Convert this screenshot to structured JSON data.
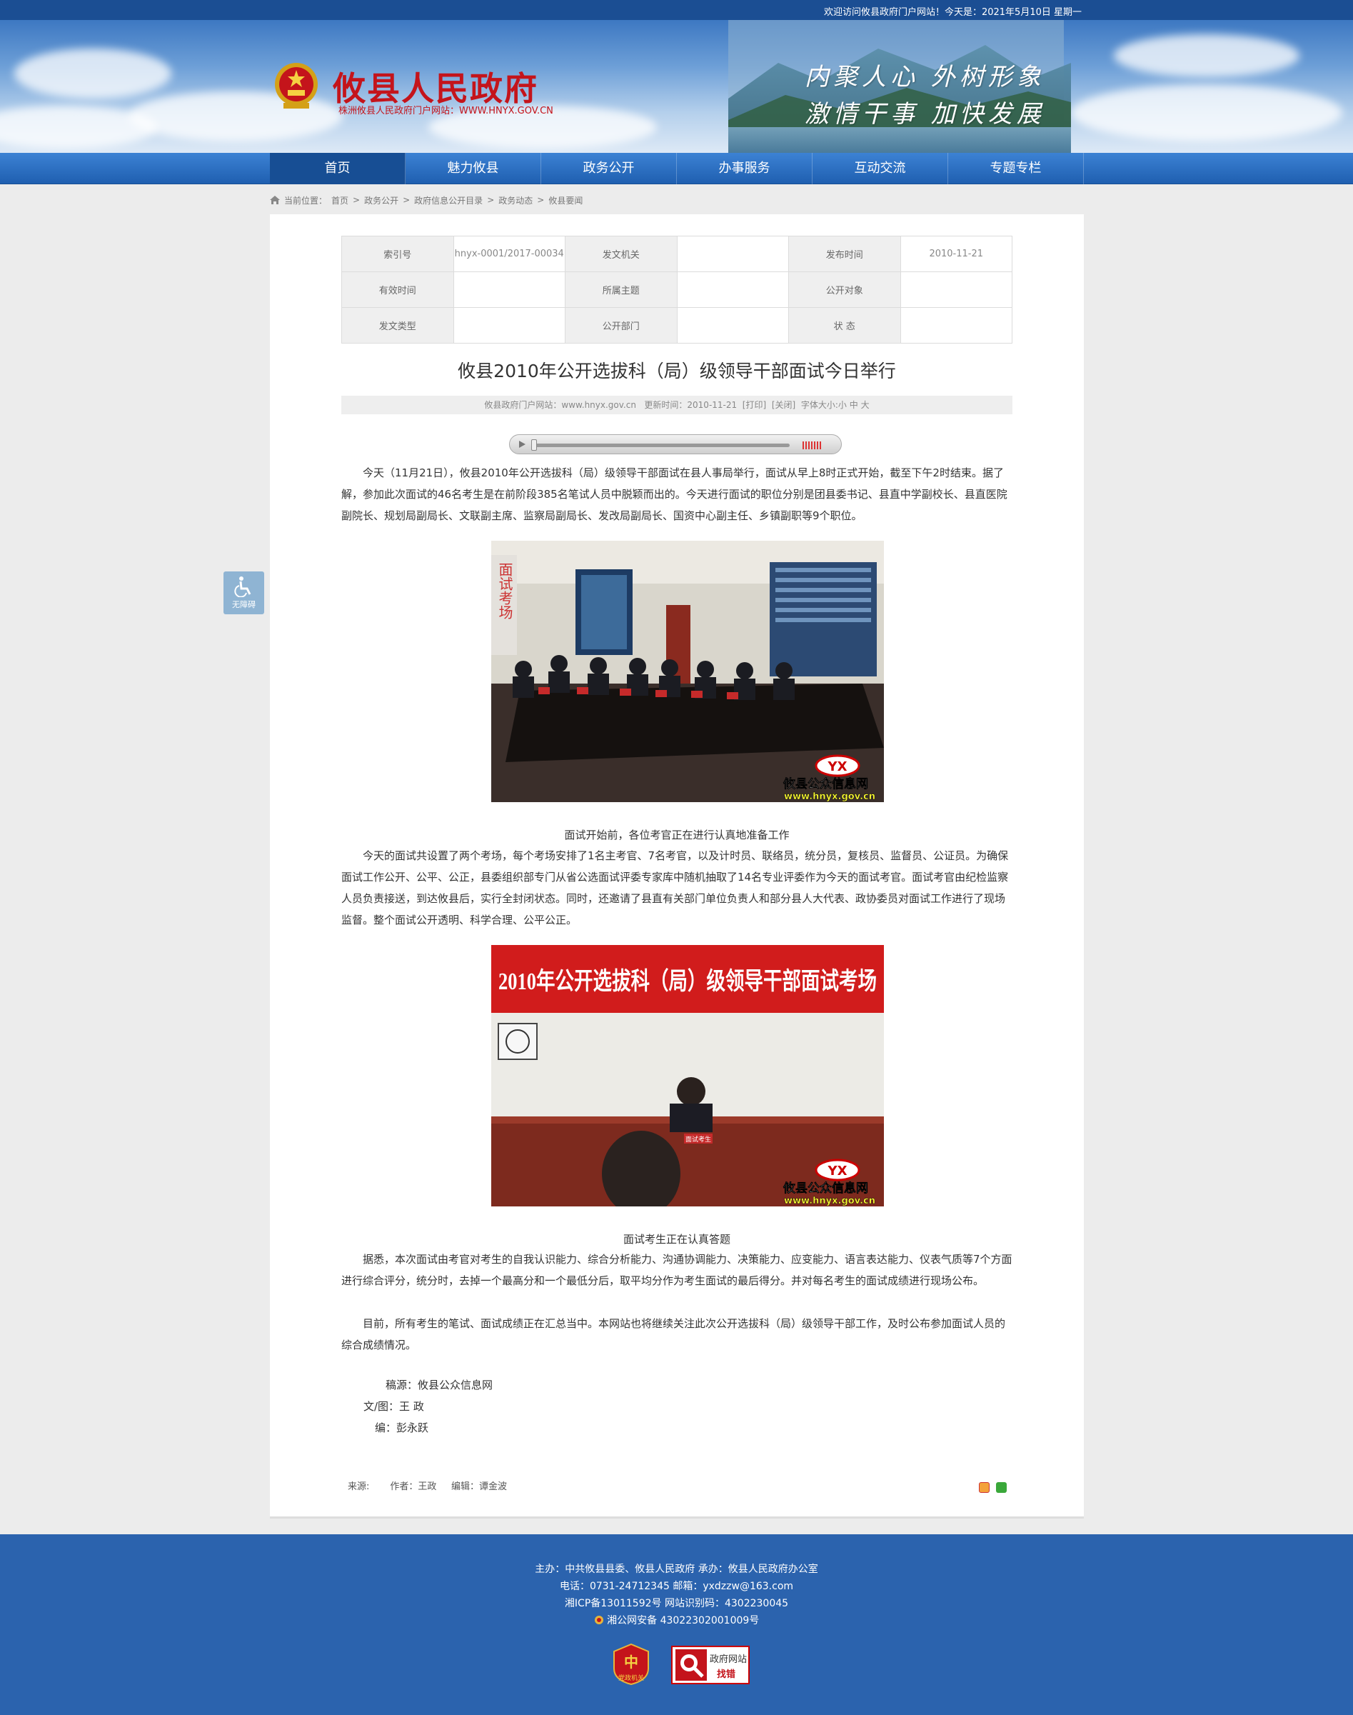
{
  "topbar": {
    "welcome": "欢迎访问攸县政府门户网站！今天是：2021年5月10日 星期一"
  },
  "header": {
    "title": "攸县人民政府",
    "subtitle": "株洲攸县人民政府门户网站：WWW.HNYX.GOV.CN",
    "slogan1": "内聚人心  外树形象",
    "slogan2": "激情干事  加快发展",
    "brand_red": "#c4141b"
  },
  "nav": [
    {
      "label": "首页",
      "active": true
    },
    {
      "label": "魅力攸县"
    },
    {
      "label": "政务公开"
    },
    {
      "label": "办事服务"
    },
    {
      "label": "互动交流"
    },
    {
      "label": "专题专栏"
    }
  ],
  "breadcrumb": {
    "prefix": "当前位置：",
    "items": [
      "首页",
      "政务公开",
      "政府信息公开目录",
      "政务动态",
      "攸县要闻"
    ],
    "sep": ">"
  },
  "info_table": [
    [
      {
        "k": "索引号"
      },
      {
        "v": "hnyx-0001/2017-00034"
      },
      {
        "k": "发文机关"
      },
      {
        "v": ""
      },
      {
        "k": "发布时间"
      },
      {
        "v": "2010-11-21"
      }
    ],
    [
      {
        "k": "有效时间"
      },
      {
        "v": ""
      },
      {
        "k": "所属主题"
      },
      {
        "v": ""
      },
      {
        "k": "公开对象"
      },
      {
        "v": ""
      }
    ],
    [
      {
        "k": "发文类型"
      },
      {
        "v": ""
      },
      {
        "k": "公开部门"
      },
      {
        "v": ""
      },
      {
        "k": "状    态"
      },
      {
        "v": ""
      }
    ]
  ],
  "article": {
    "title": "攸县2010年公开选拔科（局）级领导干部面试今日举行",
    "meta_site": "攸县政府门户网站：www.hnyx.gov.cn",
    "meta_update": "更新时间：2010-11-21",
    "meta_print": "[打印]",
    "meta_close": "[关闭]",
    "meta_font": "字体大小:",
    "meta_small": "小",
    "meta_mid": "中",
    "meta_big": "大",
    "p1": "今天（11月21日），攸县2010年公开选拔科（局）级领导干部面试在县人事局举行，面试从早上8时正式开始，截至下午2时结束。据了解，参加此次面试的46名考生是在前阶段385名笔试人员中脱颖而出的。今天进行面试的职位分别是团县委书记、县直中学副校长、县直医院副院长、规划局副局长、文联副主席、监察局副局长、发改局副局长、国资中心副主任、乡镇副职等9个职位。",
    "photo1_watermark1": "攸县公众信息网",
    "photo1_watermark2": "www.hnyx.gov.cn",
    "photo1_logo": "YX",
    "photo1_banner": "面试考场",
    "caption1": "面试开始前，各位考官正在进行认真地准备工作",
    "p2": "今天的面试共设置了两个考场，每个考场安排了1名主考官、7名考官，以及计时员、联络员，统分员，复核员、监督员、公证员。为确保面试工作公开、公平、公正，县委组织部专门从省公选面试评委专家库中随机抽取了14名专业评委作为今天的面试考官。面试考官由纪检监察人员负责接送，到达攸县后，实行全封闭状态。同时，还邀请了县直有关部门单位负责人和部分县人大代表、政协委员对面试工作进行了现场监督。整个面试公开透明、科学合理、公平公正。",
    "photo2_banner": "2010年公开选拔科（局）级领导干部面试考场",
    "photo2_nameplate": "面试考生",
    "photo2_watermark1": "攸县公众信息网",
    "photo2_watermark2": "www.hnyx.gov.cn",
    "photo2_logo": "YX",
    "caption2": "面试考生正在认真答题",
    "p3": "据悉，本次面试由考官对考生的自我认识能力、综合分析能力、沟通协调能力、决策能力、应变能力、语言表达能力、仪表气质等7个方面进行综合评分，统分时，去掉一个最高分和一个最低分后，取平均分作为考生面试的最后得分。并对每名考生的面试成绩进行现场公布。",
    "p4": "目前，所有考生的笔试、面试成绩正在汇总当中。本网站也将继续关注此次公开选拔科（局）级领导干部工作，及时公布参加面试人员的综合成绩情况。",
    "sign_source": "稿源：攸县公众信息网",
    "sign_author": "文/图：王   政",
    "sign_editor": "编：彭永跃",
    "bottom_source": "来源:",
    "bottom_author": "作者：王政",
    "bottom_editor": "编辑：谭金波"
  },
  "player": {
    "accent": "#d33333"
  },
  "accessibility": {
    "label": "无障碍"
  },
  "footer": {
    "line1": "主办：中共攸县县委、攸县人民政府  承办：攸县人民政府办公室",
    "line2": "电话：0731-24712345  邮箱：yxdzzw@163.com",
    "line3": "湘ICP备13011592号    网站识别码：4302230045",
    "line4": "湘公网安备 43022302001009号",
    "badge1_label": "党政机关",
    "badge2_top": "政府网站",
    "badge2_bottom": "找错",
    "bg": "#2b63ae"
  }
}
